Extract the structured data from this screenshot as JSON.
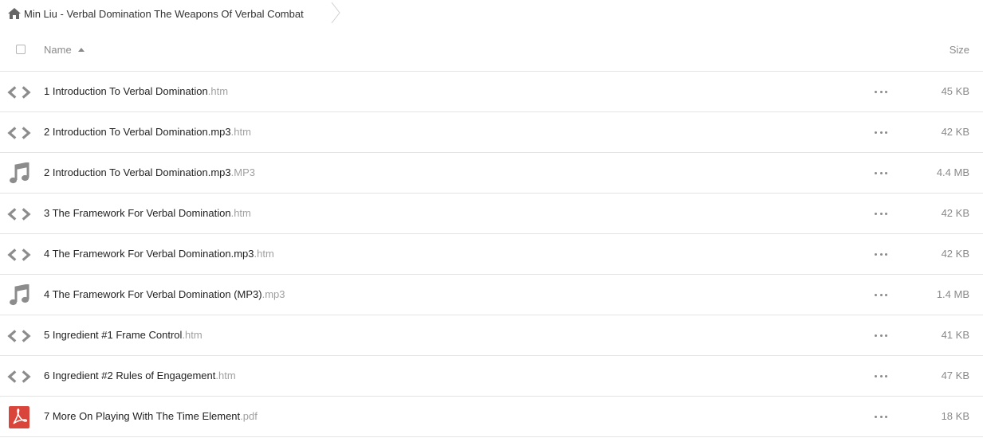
{
  "breadcrumb": {
    "title": "Min Liu - Verbal Domination The Weapons Of Verbal Combat",
    "home_icon": "home-icon"
  },
  "header": {
    "name_label": "Name",
    "size_label": "Size"
  },
  "files": [
    {
      "name": "1 Introduction To Verbal Domination",
      "ext": ".htm",
      "size": "45 KB",
      "icon": "code-icon"
    },
    {
      "name": "2 Introduction To Verbal Domination.mp3",
      "ext": ".htm",
      "size": "42 KB",
      "icon": "code-icon"
    },
    {
      "name": "2 Introduction To Verbal Domination.mp3",
      "ext": ".MP3",
      "size": "4.4 MB",
      "icon": "music-icon"
    },
    {
      "name": "3 The Framework For Verbal Domination",
      "ext": ".htm",
      "size": "42 KB",
      "icon": "code-icon"
    },
    {
      "name": "4 The Framework For Verbal Domination.mp3",
      "ext": ".htm",
      "size": "42 KB",
      "icon": "code-icon"
    },
    {
      "name": "4 The Framework For Verbal Domination (MP3)",
      "ext": ".mp3",
      "size": "1.4 MB",
      "icon": "music-icon"
    },
    {
      "name": "5 Ingredient #1 Frame Control",
      "ext": ".htm",
      "size": "41 KB",
      "icon": "code-icon"
    },
    {
      "name": "6 Ingredient #2 Rules of Engagement",
      "ext": ".htm",
      "size": "47 KB",
      "icon": "code-icon"
    },
    {
      "name": "7 More On Playing With The Time Element",
      "ext": ".pdf",
      "size": "18 KB",
      "icon": "pdf-icon"
    }
  ],
  "colors": {
    "icon_gray": "#8c8c8c",
    "pdf_red": "#d9453a",
    "ext_gray": "#a0a0a0",
    "divider": "#e4e4e4"
  }
}
